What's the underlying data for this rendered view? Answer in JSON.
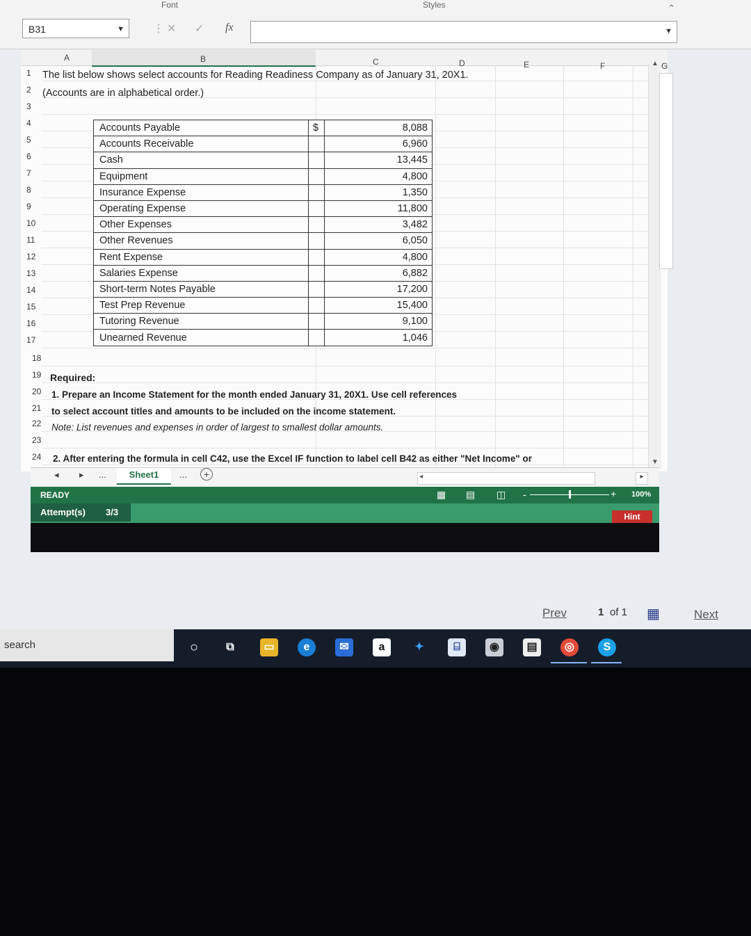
{
  "ribbon": {
    "group_font": "Font",
    "group_styles": "Styles"
  },
  "name_box": {
    "value": "B31"
  },
  "formula_bar": {
    "fx_symbol": "fx",
    "value": ""
  },
  "columns": [
    "A",
    "B",
    "C",
    "D",
    "E",
    "F",
    "G"
  ],
  "rows": [
    "1",
    "2",
    "3",
    "4",
    "5",
    "6",
    "7",
    "8",
    "9",
    "10",
    "11",
    "12",
    "13",
    "14",
    "15",
    "16",
    "17",
    "18",
    "19",
    "20",
    "21",
    "22",
    "23",
    "24"
  ],
  "sheet": {
    "intro_line1": "The list below shows select accounts for Reading Readiness Company as of January 31, 20X1.",
    "intro_line2": "(Accounts are in alphabetical order.)",
    "currency_symbol": "$",
    "accounts": [
      {
        "name": "Accounts Payable",
        "amount": "8,088"
      },
      {
        "name": "Accounts Receivable",
        "amount": "6,960"
      },
      {
        "name": "Cash",
        "amount": "13,445"
      },
      {
        "name": "Equipment",
        "amount": "4,800"
      },
      {
        "name": "Insurance Expense",
        "amount": "1,350"
      },
      {
        "name": "Operating Expense",
        "amount": "11,800"
      },
      {
        "name": "Other Expenses",
        "amount": "3,482"
      },
      {
        "name": "Other Revenues",
        "amount": "6,050"
      },
      {
        "name": "Rent Expense",
        "amount": "4,800"
      },
      {
        "name": "Salaries Expense",
        "amount": "6,882"
      },
      {
        "name": "Short-term Notes Payable",
        "amount": "17,200"
      },
      {
        "name": "Test Prep Revenue",
        "amount": "15,400"
      },
      {
        "name": "Tutoring Revenue",
        "amount": "9,100"
      },
      {
        "name": "Unearned Revenue",
        "amount": "1,046"
      }
    ],
    "required_label": "Required:",
    "req1_line1": "1. Prepare an Income Statement for the month ended January 31, 20X1.  Use cell references",
    "req1_line2": "to select account titles and amounts to be included on the income statement.",
    "note": "Note:  List revenues and expenses in order of largest to smallest dollar amounts.",
    "req2_line1": "2. After entering the formula in cell C42, use the Excel IF function to label cell B42 as either \"Net Income\" or"
  },
  "tabs": {
    "sheet_name": "Sheet1",
    "ellipsis": "...",
    "add": "+"
  },
  "status": {
    "ready": "READY",
    "zoom": "100%"
  },
  "attempts": {
    "label": "Attempt(s)",
    "value": "3/3",
    "hint": "Hint"
  },
  "pager": {
    "prev": "Prev",
    "page": "1",
    "of": "of 1",
    "next": "Next"
  },
  "taskbar": {
    "search": "search"
  },
  "colors": {
    "excel_green": "#217346",
    "attempt_bar": "#3a9c6c",
    "hint_red": "#c9302c"
  }
}
